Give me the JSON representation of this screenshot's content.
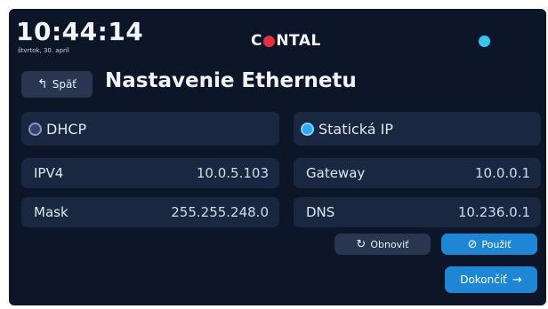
{
  "header": {
    "time": "10:44:14",
    "date": "štvrtok, 30. apríl",
    "logo_pre": "C",
    "logo_o": "●",
    "logo_post": "NTAL"
  },
  "nav": {
    "back_label": "Späť",
    "title": "Nastavenie Ethernetu"
  },
  "modes": {
    "dhcp": "DHCP",
    "static": "Statická IP",
    "selected": "static"
  },
  "fields": {
    "ipv4_label": "IPV4",
    "ipv4_value": "10.0.5.103",
    "gateway_label": "Gateway",
    "gateway_value": "10.0.0.1",
    "mask_label": "Mask",
    "mask_value": "255.255.248.0",
    "dns_label": "DNS",
    "dns_value": "10.236.0.1"
  },
  "actions": {
    "refresh_label": "Obnoviť",
    "apply_label": "Použiť",
    "finish_label": "Dokončiť"
  },
  "colors": {
    "background": "#0d1628",
    "card": "#1a2740",
    "accent": "#1f86d6",
    "status_dot": "#3cc4f0",
    "logo_accent": "#e0323a"
  }
}
